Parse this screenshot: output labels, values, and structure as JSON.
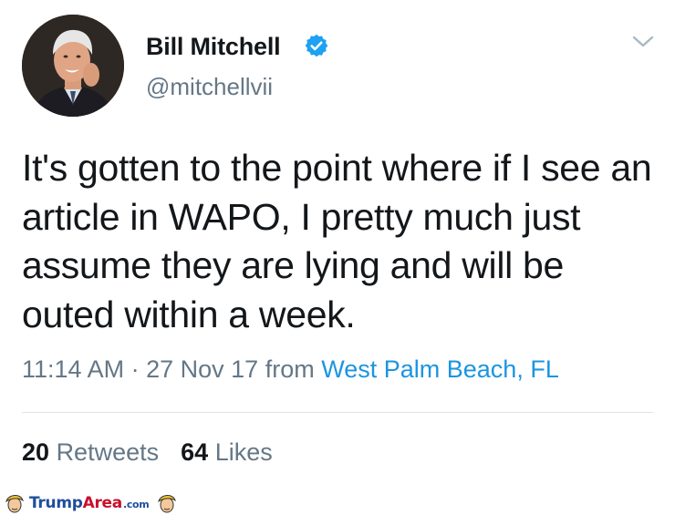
{
  "user": {
    "display_name": "Bill Mitchell",
    "handle": "@mitchellvii",
    "verified": true
  },
  "tweet": {
    "text": "It's gotten to the point where if I see an article in WAPO, I pretty much just assume they are lying and will be outed within a week.",
    "time": "11:14 AM",
    "separator": "·",
    "date": "27 Nov 17",
    "from_label": "from",
    "location": "West Palm Beach, FL"
  },
  "stats": {
    "retweets_count": "20",
    "retweets_label": "Retweets",
    "likes_count": "64",
    "likes_label": "Likes"
  },
  "watermark": {
    "trump": "Trump",
    "area": "Area",
    "dotcom": ".com"
  },
  "colors": {
    "text": "#14171a",
    "secondary": "#657786",
    "link": "#1b95e0",
    "verified": "#1da1f2"
  },
  "icons": {
    "verified": "verified-badge-icon",
    "menu": "chevron-down-icon"
  }
}
